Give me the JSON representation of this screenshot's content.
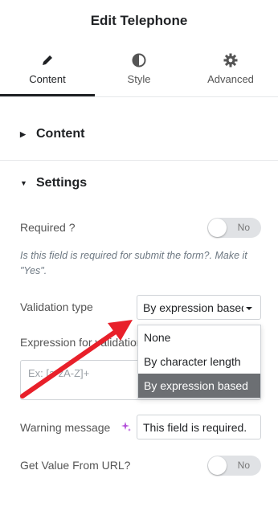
{
  "header": {
    "title": "Edit Telephone"
  },
  "tabs": [
    {
      "label": "Content",
      "icon": "pencil-icon",
      "active": true
    },
    {
      "label": "Style",
      "icon": "half-circle-icon",
      "active": false
    },
    {
      "label": "Advanced",
      "icon": "gear-icon",
      "active": false
    }
  ],
  "sections": {
    "content": {
      "label": "Content",
      "expanded": false
    },
    "settings": {
      "label": "Settings",
      "expanded": true
    }
  },
  "fields": {
    "required": {
      "label": "Required ?",
      "toggle_text": "No",
      "note": "Is this field is required for submit the form?. Make it \"Yes\"."
    },
    "validation_type": {
      "label": "Validation type",
      "value": "By expression based",
      "options": [
        "None",
        "By character length",
        "By expression based"
      ],
      "selected_index": 2
    },
    "expression": {
      "label": "Expression for validation",
      "placeholder": "Ex: [a-zA-Z]+"
    },
    "warning": {
      "label": "Warning message",
      "value": "This field is required."
    },
    "get_value_from_url": {
      "label": "Get Value From URL?",
      "toggle_text": "No"
    }
  },
  "colors": {
    "annotation_arrow": "#e8202a",
    "selected_option_bg": "#6c6f73",
    "sparkle": "#b34fd9"
  }
}
